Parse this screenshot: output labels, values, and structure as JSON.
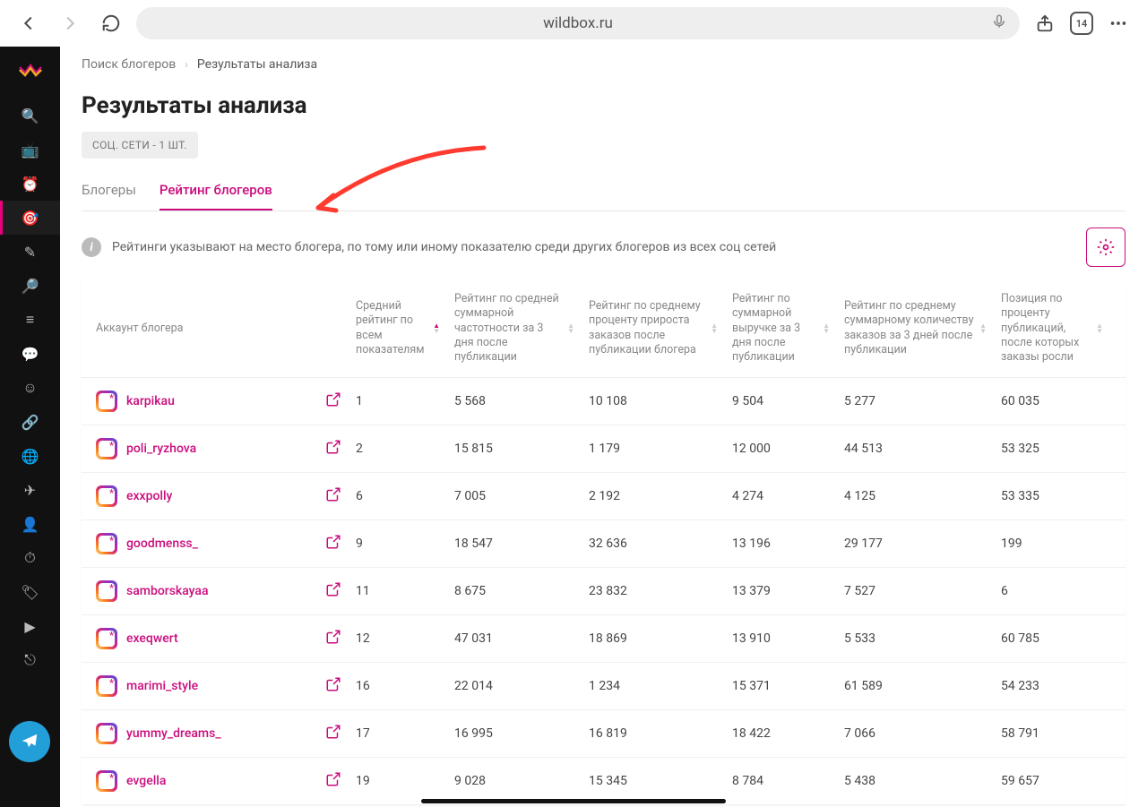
{
  "browser": {
    "url": "wildbox.ru",
    "tab_count": "14"
  },
  "breadcrumbs": {
    "root": "Поиск блогеров",
    "current": "Результаты анализа"
  },
  "page": {
    "title": "Результаты анализа",
    "pill": "СОЦ. СЕТИ - 1 ШТ."
  },
  "tabs": {
    "bloggers": "Блогеры",
    "rating": "Рейтинг блогеров"
  },
  "info": {
    "text": "Рейтинги указывают на место блогера, по тому или иному показателю среди других блогеров из всех соц сетей"
  },
  "columns": {
    "c0": "Аккаунт блогера",
    "c1": "Средний рейтинг по всем показателям",
    "c2": "Рейтинг по средней суммарной частотности за 3 дня после публикации",
    "c3": "Рейтинг по среднему проценту прироста заказов после публикации блогера",
    "c4": "Рейтинг по суммарной выручке за 3 дня после публикации",
    "c5": "Рейтинг по среднему суммарному количеству заказов за 3 дней после публикации",
    "c6": "Позиция по проценту публикаций, после которых заказы росли"
  },
  "rows": [
    {
      "name": "karpikau",
      "c1": "1",
      "c2": "5 568",
      "c3": "10 108",
      "c4": "9 504",
      "c5": "5 277",
      "c6": "60 035"
    },
    {
      "name": "poli_ryzhova",
      "c1": "2",
      "c2": "15 815",
      "c3": "1 179",
      "c4": "12 000",
      "c5": "44 513",
      "c6": "53 325"
    },
    {
      "name": "exxpolly",
      "c1": "6",
      "c2": "7 005",
      "c3": "2 192",
      "c4": "4 274",
      "c5": "4 125",
      "c6": "53 335"
    },
    {
      "name": "goodmenss_",
      "c1": "9",
      "c2": "18 547",
      "c3": "32 636",
      "c4": "13 196",
      "c5": "29 177",
      "c6": "199"
    },
    {
      "name": "samborskayaa",
      "c1": "11",
      "c2": "8 675",
      "c3": "23 832",
      "c4": "13 379",
      "c5": "7 527",
      "c6": "6"
    },
    {
      "name": "exeqwert",
      "c1": "12",
      "c2": "47 031",
      "c3": "18 869",
      "c4": "13 910",
      "c5": "5 533",
      "c6": "60 785"
    },
    {
      "name": "marimi_style",
      "c1": "16",
      "c2": "22 014",
      "c3": "1 234",
      "c4": "15 371",
      "c5": "61 589",
      "c6": "54 233"
    },
    {
      "name": "yummy_dreams_",
      "c1": "17",
      "c2": "16 995",
      "c3": "16 819",
      "c4": "18 422",
      "c5": "7 066",
      "c6": "58 791"
    },
    {
      "name": "evgella",
      "c1": "19",
      "c2": "9 028",
      "c3": "15 345",
      "c4": "8 784",
      "c5": "5 438",
      "c6": "59 657"
    }
  ]
}
